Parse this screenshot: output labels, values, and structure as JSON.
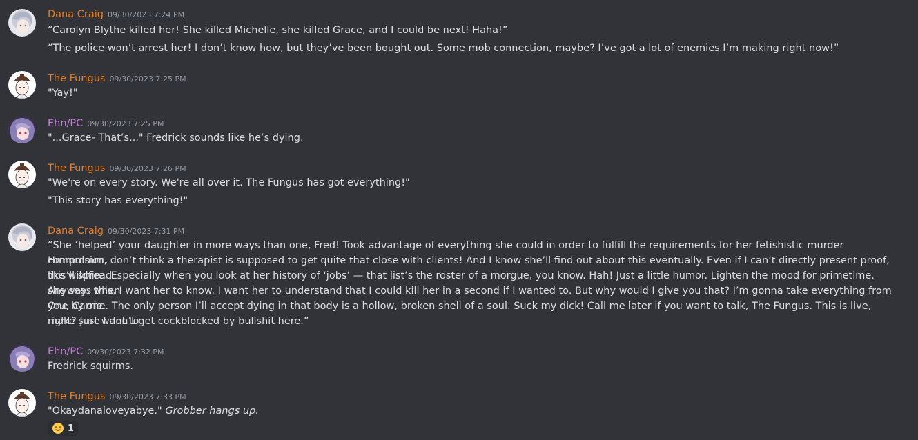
{
  "colors": {
    "dana": "#e67e22",
    "fungus": "#e67e22",
    "ehn": "#c27ed6",
    "background": "#313338",
    "text": "#dbdee1",
    "timestamp": "#949ba4"
  },
  "messages": [
    {
      "author": "Dana Craig",
      "timestamp": "09/30/2023 7:24 PM",
      "avatar": "white-hair-avatar",
      "lines": [
        "“Carolyn Blythe killed her! She killed Michelle, she killed Grace, and I could be next! Haha!”",
        "“The police won’t arrest her! I don’t know how, but they’ve been bought out. Some mob connection, maybe? I’ve got a lot of enemies I’m making right now!”"
      ]
    },
    {
      "author": "The Fungus",
      "timestamp": "09/30/2023 7:25 PM",
      "avatar": "mushroom-hat-avatar",
      "lines": [
        "\"Yay!\""
      ]
    },
    {
      "author": "Ehn/PC",
      "timestamp": "09/30/2023 7:25 PM",
      "avatar": "anime-avatar",
      "lines": [
        "\"...Grace- That’s...\" Fredrick sounds like he’s dying."
      ]
    },
    {
      "author": "The Fungus",
      "timestamp": "09/30/2023 7:26 PM",
      "avatar": "mushroom-hat-avatar",
      "lines": [
        "\"We're on every story. We're all over it. The Fungus has got everything!\"",
        "\"This story has everything!\""
      ]
    },
    {
      "author": "Dana Craig",
      "timestamp": "09/30/2023 7:31 PM",
      "avatar": "white-hair-avatar",
      "lines": [
        "“She ‘helped’ your daughter in more ways than one, Fred! Took advantage of everything she could in order to fulfill the requirements for her fetishistic murder compulsion.",
        "Hmmmmm, don’t think a therapist is supposed to get quite that close with clients! And I know she’ll find out about this eventually. Even if I can’t directly present proof, this’ll spread",
        "like wildfire. Especially when you look at her history of ‘jobs’ — that list’s the roster of a morgue, you know. Hah! Just a little humor. Lighten the mood for primetime. Anyway, when",
        "she sees this, I want her to know. I want her to understand that I could kill her in a second if I wanted to. But why would I give you that? I’m gonna take everything from you, Carrie.",
        "One by one. The only person I’ll accept dying in that body is a hollow, broken shell of a soul. Suck my dick! Call me later if you want to talk, The Fungus. This is live, right? Just want to",
        "make sure I don’t get cockblocked by bullshit here.”"
      ]
    },
    {
      "author": "Ehn/PC",
      "timestamp": "09/30/2023 7:32 PM",
      "avatar": "anime-avatar",
      "lines": [
        "Fredrick squirms."
      ]
    },
    {
      "author": "The Fungus",
      "timestamp": "09/30/2023 7:33 PM",
      "avatar": "mushroom-hat-avatar",
      "lines": [
        "\"Okaydanaloveyabye.\" "
      ],
      "italic": "Grobber hangs up.",
      "reaction": {
        "emoji": "smiling-face-emoji",
        "count": "1"
      }
    }
  ]
}
